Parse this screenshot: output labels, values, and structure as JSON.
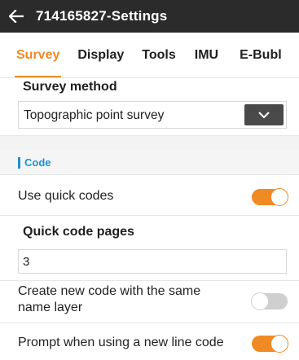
{
  "header": {
    "title": "714165827-Settings",
    "back_icon": "arrow-left-icon"
  },
  "tabs": [
    {
      "label": "Survey",
      "active": true
    },
    {
      "label": "Display",
      "active": false
    },
    {
      "label": "Tools",
      "active": false
    },
    {
      "label": "IMU",
      "active": false
    },
    {
      "label": "E-Bubl",
      "active": false
    }
  ],
  "survey_method": {
    "label": "Survey method",
    "value": "Topographic point survey",
    "dropdown_icon": "chevron-down-icon"
  },
  "code_section": {
    "title": "Code",
    "use_quick_codes": {
      "label": "Use quick codes",
      "on": true
    },
    "quick_code_pages": {
      "label": "Quick code pages",
      "value": "3"
    },
    "create_new_code": {
      "label_line1": "Create new code with the same",
      "label_line2": "name layer",
      "on": false
    },
    "prompt_new_line_code": {
      "label": "Prompt when using a new line code",
      "on": true
    }
  },
  "colors": {
    "accent": "#f08a24",
    "header_bg": "#2b2b2b",
    "section_title": "#1e90d6"
  }
}
